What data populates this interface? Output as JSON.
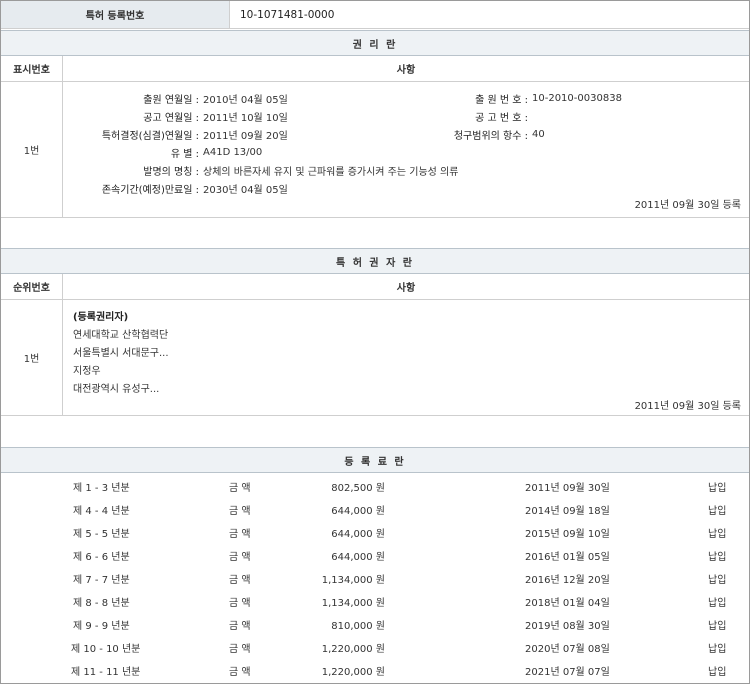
{
  "reg_number_label": "특허 등록번호",
  "reg_number_value": "10-1071481-0000",
  "rights": {
    "section_title": "권 리 란",
    "col_num": "표시번호",
    "col_content": "사항",
    "row_num": "1번",
    "fields": [
      {
        "key": "출원 연월일 :",
        "value": "2010년 04월 05일"
      },
      {
        "key": "공고 연월일 :",
        "value": "2011년 10월 10일"
      },
      {
        "key": "특허결정(심결)연월일 :",
        "value": "2011년 09월 20일"
      },
      {
        "key": "유 별 :",
        "value": "A41D 13/00"
      },
      {
        "key": "발명의 명칭 :",
        "value": "상체의 바른자세 유지 및 근파워를 증가시켜 주는 기능성 의류"
      },
      {
        "key": "존속기간(예정)만료일 :",
        "value": "2030년 04월 05일"
      }
    ],
    "fields_right": [
      {
        "key": "출 원 번 호 :",
        "value": "10-2010-0030838"
      },
      {
        "key": "공 고 번 호 :",
        "value": ""
      },
      {
        "key": "청구범위의 항수 :",
        "value": "40"
      }
    ],
    "registered": "2011년 09월 30일 등록"
  },
  "owners": {
    "section_title": "특 허 권 자 란",
    "col_num": "순위번호",
    "col_content": "사항",
    "row_num": "1번",
    "heading": "(등록권리자)",
    "lines": [
      "연세대학교 산학협력단",
      "서울특별시 서대문구...",
      "지정우",
      "대전광역시 유성구..."
    ],
    "registered": "2011년 09월 30일 등록"
  },
  "fees": {
    "section_title": "등 록 료 란",
    "amount_label": "금 액",
    "rows": [
      {
        "period": "제 1 - 3 년분",
        "amount": "802,500 원",
        "date": "2011년 09월 30일",
        "status": "납입"
      },
      {
        "period": "제 4 - 4 년분",
        "amount": "644,000 원",
        "date": "2014년 09월 18일",
        "status": "납입"
      },
      {
        "period": "제 5 - 5 년분",
        "amount": "644,000 원",
        "date": "2015년 09월 10일",
        "status": "납입"
      },
      {
        "period": "제 6 - 6 년분",
        "amount": "644,000 원",
        "date": "2016년 01월 05일",
        "status": "납입"
      },
      {
        "period": "제 7 - 7 년분",
        "amount": "1,134,000 원",
        "date": "2016년 12월 20일",
        "status": "납입"
      },
      {
        "period": "제 8 - 8 년분",
        "amount": "1,134,000 원",
        "date": "2018년 01월 04일",
        "status": "납입"
      },
      {
        "period": "제 9 - 9 년분",
        "amount": "810,000 원",
        "date": "2019년 08월 30일",
        "status": "납입"
      },
      {
        "period": "제 10 - 10 년분",
        "amount": "1,220,000 원",
        "date": "2020년 07월 08일",
        "status": "납입"
      },
      {
        "period": "제 11 - 11 년분",
        "amount": "1,220,000 원",
        "date": "2021년 07월 07일",
        "status": "납입"
      }
    ]
  }
}
